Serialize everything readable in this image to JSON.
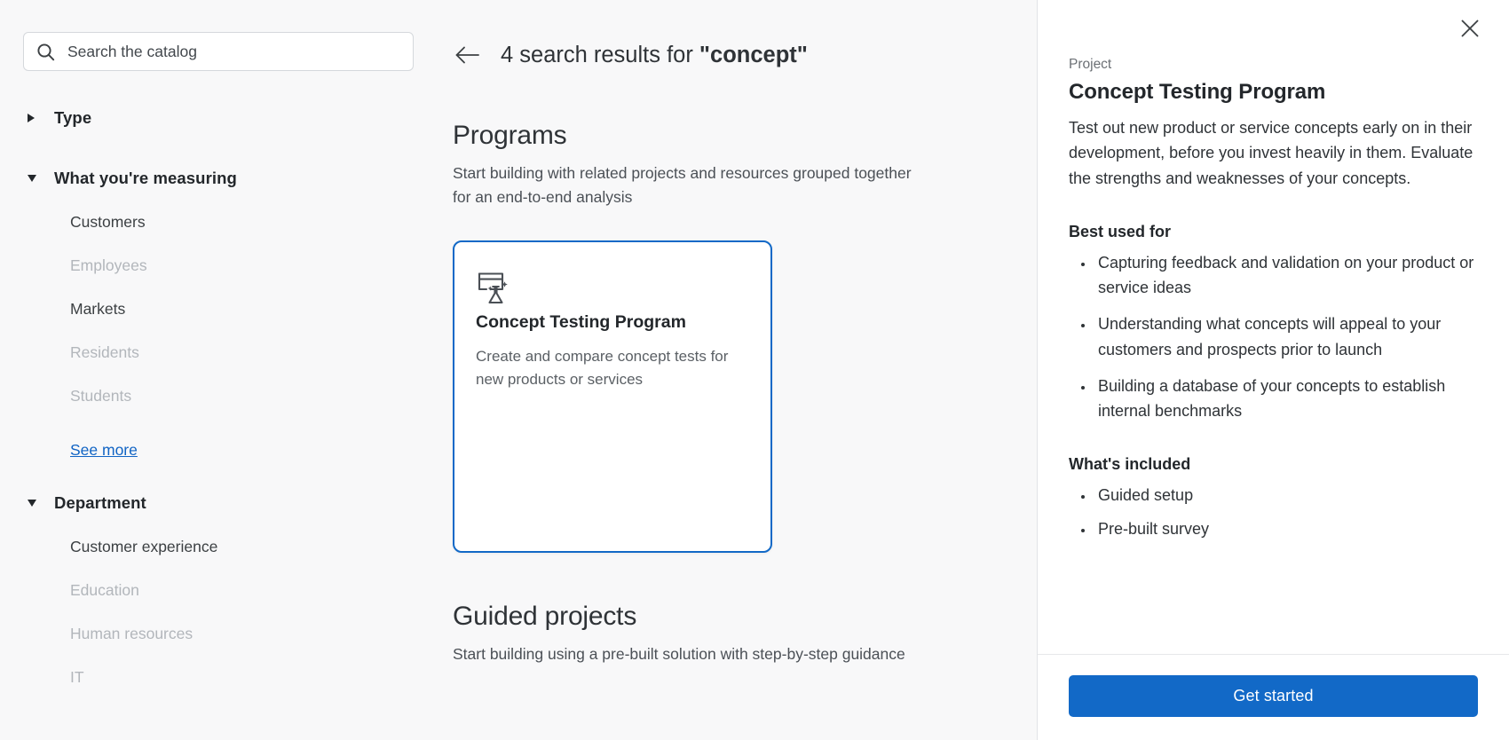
{
  "colors": {
    "accent": "#1269c7",
    "link": "#1164c4",
    "page_bg": "#f8f8f9",
    "panel_bg": "#ffffff",
    "text": "#2f3337",
    "muted": "#b2b6bb"
  },
  "search": {
    "placeholder": "Search the catalog",
    "value": "",
    "icon": "search-icon"
  },
  "facets": [
    {
      "id": "type",
      "title": "Type",
      "expanded": false,
      "caret": "caret-right-icon",
      "options": []
    },
    {
      "id": "what-youre-measuring",
      "title": "What you're measuring",
      "expanded": true,
      "caret": "caret-down-icon",
      "options": [
        {
          "label": "Customers",
          "disabled": false
        },
        {
          "label": "Employees",
          "disabled": true
        },
        {
          "label": "Markets",
          "disabled": false
        },
        {
          "label": "Residents",
          "disabled": true
        },
        {
          "label": "Students",
          "disabled": true
        }
      ],
      "see_more_label": "See more"
    },
    {
      "id": "department",
      "title": "Department",
      "expanded": true,
      "caret": "caret-down-icon",
      "options": [
        {
          "label": "Customer experience",
          "disabled": false
        },
        {
          "label": "Education",
          "disabled": true
        },
        {
          "label": "Human resources",
          "disabled": true
        },
        {
          "label": "IT",
          "disabled": true
        }
      ]
    }
  ],
  "results": {
    "back_icon": "arrow-left-icon",
    "count": "4",
    "title_prefix": "4 search results for ",
    "query": "\"concept\""
  },
  "sections": [
    {
      "id": "programs",
      "title": "Programs",
      "subtitle": "Start building with related projects and resources grouped together for an end-to-end analysis",
      "cards": [
        {
          "icon": "concept-test-flask-icon",
          "title": "Concept Testing Program",
          "description": "Create and compare concept tests for new products or services",
          "selected": true
        }
      ]
    },
    {
      "id": "guided-projects",
      "title": "Guided projects",
      "subtitle": "Start building using a pre-built solution with step-by-step guidance",
      "cards": []
    }
  ],
  "panel": {
    "close_icon": "close-icon",
    "eyebrow": "Project",
    "title": "Concept Testing Program",
    "description": "Test out new product or service concepts early on in their development, before you invest heavily in them. Evaluate the strengths and weaknesses of your concepts.",
    "best_used_for_heading": "Best used for",
    "best_used_for": [
      "Capturing feedback and validation on your product or service ideas",
      "Understanding what concepts will appeal to your customers and prospects prior to launch",
      "Building a database of your concepts to establish internal benchmarks"
    ],
    "included_heading": "What's included",
    "included": [
      "Guided setup",
      "Pre-built survey"
    ],
    "cta_label": "Get started"
  }
}
